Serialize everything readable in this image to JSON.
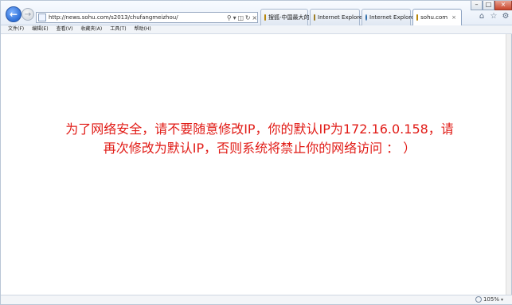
{
  "browser": {
    "address": {
      "url": "http://news.sohu.com/s2013/chufangmeizhou/"
    },
    "tabs": [
      {
        "label": "搜狐-中国最大的…"
      },
      {
        "label": "Internet Explore…"
      },
      {
        "label": "Internet Explore…"
      },
      {
        "label": "sohu.com"
      }
    ],
    "menu": [
      "文件(F)",
      "编辑(E)",
      "查看(V)",
      "收藏夹(A)",
      "工具(T)",
      "帮助(H)"
    ],
    "zoom": "105%"
  },
  "content": {
    "message_line1": "为了网络安全，请不要随意修改IP，你的默认IP为172.16.0.158，请",
    "message_line2": "再次修改为默认IP，否则系统将禁止你的网络访问 ： ）"
  },
  "colors": {
    "message": "#e11b16",
    "accent": "#2e6fd6"
  },
  "icons": {
    "back": "back-arrow-icon",
    "forward": "forward-arrow-icon",
    "home": "home-icon",
    "favorites": "star-icon",
    "tools": "gear-icon"
  }
}
